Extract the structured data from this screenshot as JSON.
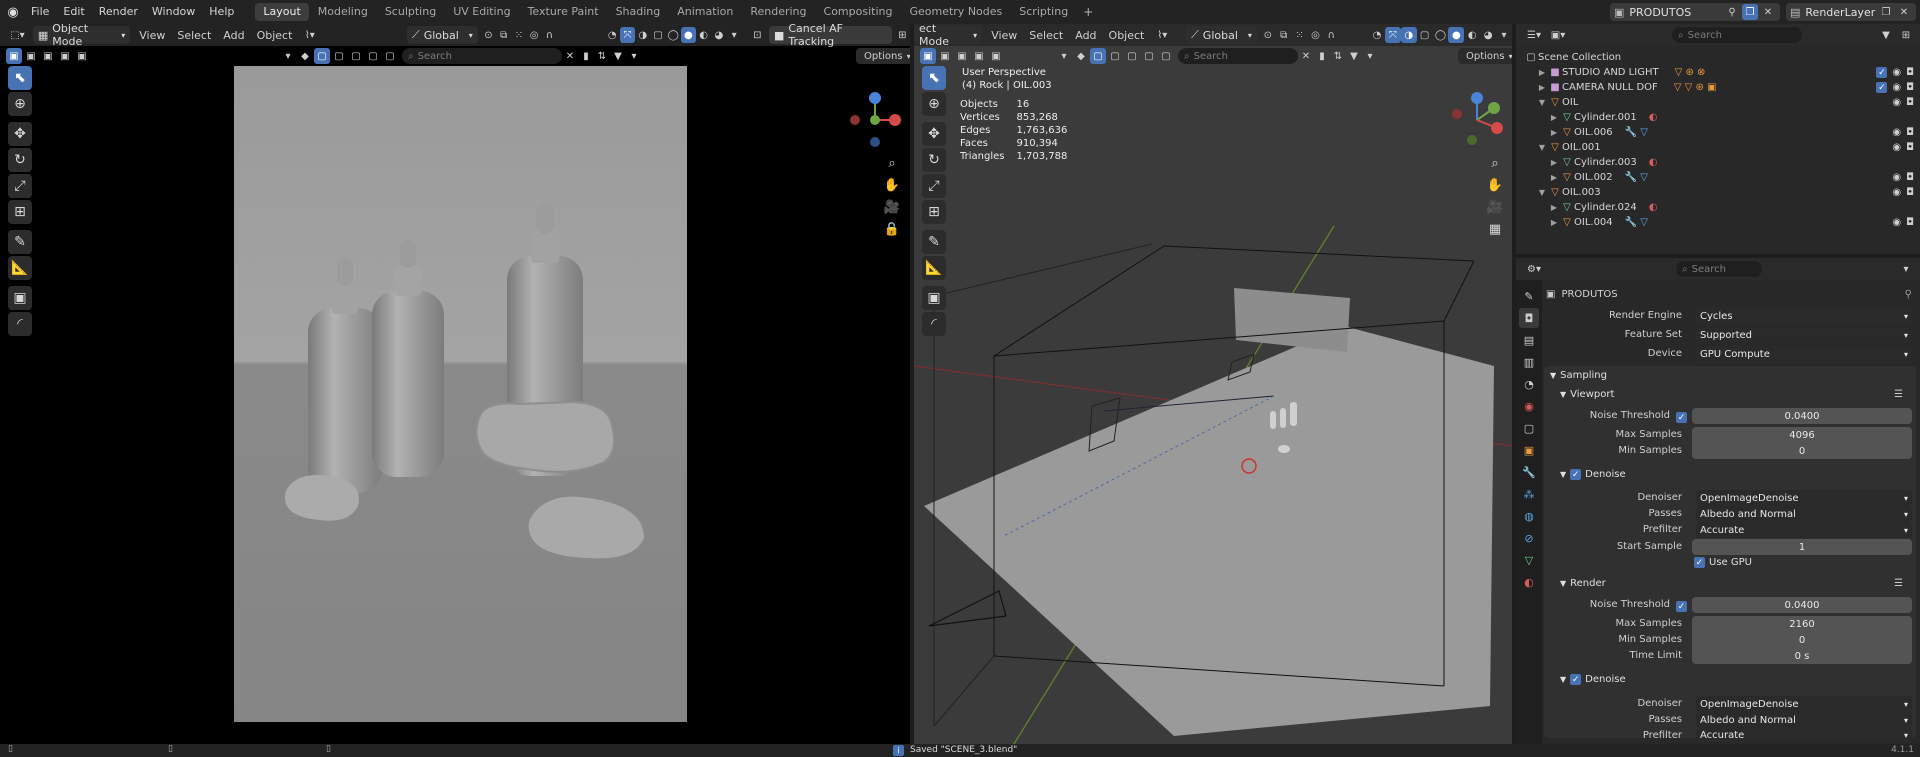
{
  "topbar": {
    "menus": [
      "File",
      "Edit",
      "Render",
      "Window",
      "Help"
    ],
    "workspaces": [
      "Layout",
      "Modeling",
      "Sculpting",
      "UV Editing",
      "Texture Paint",
      "Shading",
      "Animation",
      "Rendering",
      "Compositing",
      "Geometry Nodes",
      "Scripting"
    ],
    "active_workspace": "Layout",
    "scene_name": "PRODUTOS",
    "view_layer": "RenderLayer"
  },
  "left_viewport": {
    "mode": "Object Mode",
    "menus": [
      "View",
      "Select",
      "Add",
      "Object"
    ],
    "transform_orientation": "Global",
    "cancel_button": "Cancel AF Tracking",
    "search_placeholder": "Search",
    "options_label": "Options"
  },
  "right_viewport": {
    "mode": "ect Mode",
    "menus": [
      "View",
      "Select",
      "Add",
      "Object"
    ],
    "transform_orientation": "Global",
    "search_placeholder": "Search",
    "options_label": "Options",
    "perspective": "User Perspective",
    "context": "(4) Rock | OIL.003",
    "stats": [
      {
        "label": "Objects",
        "value": "16"
      },
      {
        "label": "Vertices",
        "value": "853,268"
      },
      {
        "label": "Edges",
        "value": "1,763,636"
      },
      {
        "label": "Faces",
        "value": "910,394"
      },
      {
        "label": "Triangles",
        "value": "1,703,788"
      }
    ]
  },
  "outliner": {
    "search_placeholder": "Search",
    "root": "Scene Collection",
    "rows": [
      {
        "label": "STUDIO AND LIGHT",
        "type": "collection"
      },
      {
        "label": "CAMERA NULL DOF",
        "type": "collection"
      },
      {
        "label": "OIL",
        "type": "empty"
      },
      {
        "label": "Cylinder.001",
        "type": "mesh"
      },
      {
        "label": "OIL.006",
        "type": "empty"
      },
      {
        "label": "OIL.001",
        "type": "empty"
      },
      {
        "label": "Cylinder.003",
        "type": "mesh"
      },
      {
        "label": "OIL.002",
        "type": "empty"
      },
      {
        "label": "OIL.003",
        "type": "empty"
      },
      {
        "label": "Cylinder.024",
        "type": "mesh"
      },
      {
        "label": "OIL.004",
        "type": "empty"
      }
    ]
  },
  "properties": {
    "search_placeholder": "Search",
    "scene": "PRODUTOS",
    "render_engine_label": "Render Engine",
    "render_engine": "Cycles",
    "feature_set_label": "Feature Set",
    "feature_set": "Supported",
    "device_label": "Device",
    "device": "GPU Compute",
    "sampling": "Sampling",
    "viewport": "Viewport",
    "noise_threshold_label": "Noise Threshold",
    "viewport_noise_threshold": "0.0400",
    "max_samples_label": "Max Samples",
    "viewport_max_samples": "4096",
    "min_samples_label": "Min Samples",
    "viewport_min_samples": "0",
    "denoise": "Denoise",
    "denoiser_label": "Denoiser",
    "viewport_denoiser": "OpenImageDenoise",
    "passes_label": "Passes",
    "viewport_passes": "Albedo and Normal",
    "prefilter_label": "Prefilter",
    "viewport_prefilter": "Accurate",
    "start_sample_label": "Start Sample",
    "viewport_start_sample": "1",
    "use_gpu": "Use GPU",
    "render": "Render",
    "render_noise_threshold": "0.0400",
    "render_max_samples": "2160",
    "render_min_samples": "0",
    "time_limit_label": "Time Limit",
    "render_time_limit": "0 s",
    "render_denoiser": "OpenImageDenoise",
    "render_passes": "Albedo and Normal",
    "render_prefilter": "Accurate"
  },
  "statusbar": {
    "message": "Saved \"SCENE_3.blend\"",
    "version": "4.1.1"
  }
}
